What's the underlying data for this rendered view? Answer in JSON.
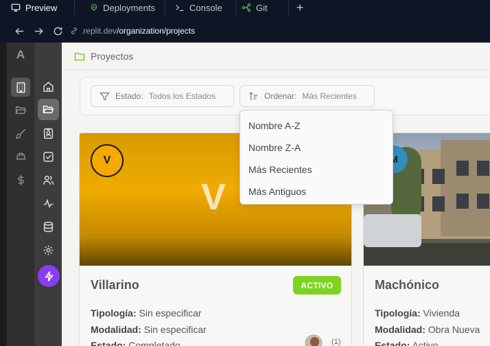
{
  "tabs": [
    {
      "label": "Preview",
      "icon": "monitor-icon",
      "active": true
    },
    {
      "label": "Deployments",
      "icon": "deployments-icon"
    },
    {
      "label": "Console",
      "icon": "terminal-icon"
    },
    {
      "label": "Git",
      "icon": "git-icon"
    }
  ],
  "url": {
    "host": ".replit.dev",
    "path": "/organization/projects"
  },
  "rail1": {
    "logo": "A"
  },
  "breadcrumb": {
    "label": "Proyectos"
  },
  "filters": {
    "estado_label": "Estado:",
    "estado_value": "Todos los Estados",
    "orden_label": "Ordenar:",
    "orden_value": "Más Recientes"
  },
  "sort_options": [
    "Nombre A-Z",
    "Nombre Z-A",
    "Más Recientes",
    "Más Antiguos"
  ],
  "projects": [
    {
      "initial": "V",
      "cover_letter": "V",
      "name": "Villarino",
      "status": "ACTIVO",
      "tipologia_label": "Tipología:",
      "tipologia": "Sin especificar",
      "modalidad_label": "Modalidad:",
      "modalidad": "Sin especificar",
      "estado_label": "Estado:",
      "estado": "Completado",
      "member_count": "(1)"
    },
    {
      "initial": "M",
      "name": "Machónico",
      "tipologia_label": "Tipología:",
      "tipologia": "Vivienda",
      "modalidad_label": "Modalidad:",
      "modalidad": "Obra Nueva",
      "estado_label": "Estado:",
      "estado": "Activo"
    }
  ],
  "colors": {
    "accent_green": "#7ed321",
    "bolt_purple": "#8b3df2",
    "card_yellow": "#f1ab00"
  }
}
